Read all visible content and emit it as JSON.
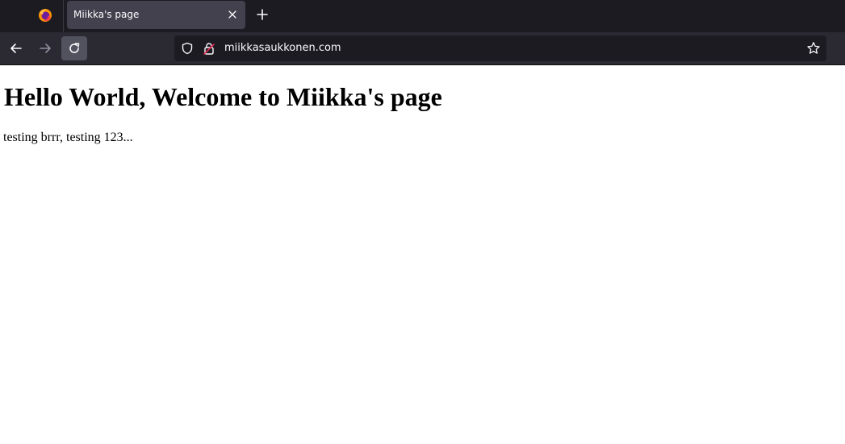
{
  "browser": {
    "tab": {
      "title": "Miikka's page"
    },
    "toolbar": {
      "url": "miikkasaukkonen.com"
    },
    "icons": {
      "app_menu": "firefox-logo-icon",
      "tab_close": "close-icon",
      "new_tab": "plus-icon",
      "back": "arrow-left-icon",
      "forward": "arrow-right-icon",
      "reload": "reload-icon",
      "tracking_protection": "shield-icon",
      "connection": "lock-icon",
      "bookmark": "star-icon"
    },
    "colors": {
      "tab_strip": "#1c1b22",
      "active_tab": "#42414d",
      "nav_bar": "#2b2a33",
      "url_field": "#1c1b22",
      "insecure_accent": "#e22850"
    }
  },
  "page": {
    "heading": "Hello World, Welcome to Miikka's page",
    "paragraph": "testing brrr, testing 123..."
  }
}
